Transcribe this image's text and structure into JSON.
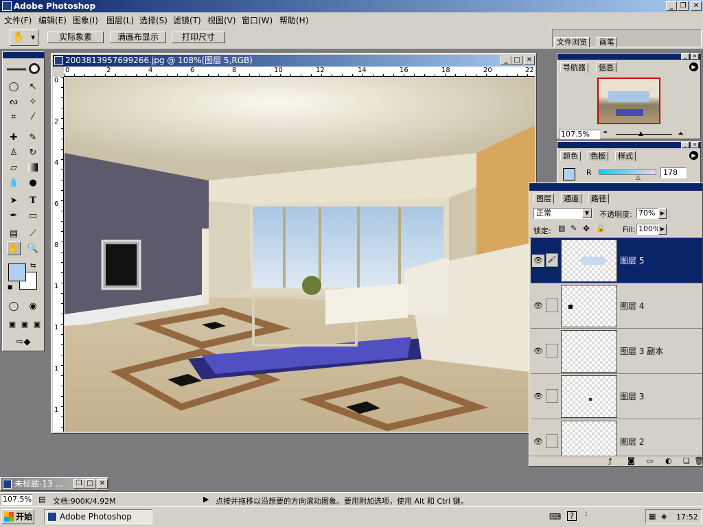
{
  "app": {
    "title": "Adobe Photoshop"
  },
  "menu": [
    "文件(F)",
    "编辑(E)",
    "图象(I)",
    "图层(L)",
    "选择(S)",
    "滤镜(T)",
    "视图(V)",
    "窗口(W)",
    "帮助(H)"
  ],
  "options": {
    "btn1": "实际象素",
    "btn2": "满画布显示",
    "btn3": "打印尺寸"
  },
  "palette_well": {
    "tab1": "文件浏览",
    "tab2": "画笔"
  },
  "document": {
    "title": "2003813957699266.jpg @ 108%(图层 5,RGB)",
    "ruler_h": [
      "0",
      "2",
      "4",
      "6",
      "8",
      "10",
      "12",
      "14",
      "16",
      "18",
      "20",
      "22"
    ],
    "ruler_v": [
      "0",
      "2",
      "4",
      "6",
      "8",
      "1",
      "1",
      "1",
      "1"
    ]
  },
  "navigator": {
    "tab1": "导航器",
    "tab2": "信息",
    "zoom": "107.5%"
  },
  "color": {
    "tab1": "颜色",
    "tab2": "色板",
    "tab3": "样式",
    "channel": "R",
    "value": "178",
    "fg": "#b0d0f0"
  },
  "layers": {
    "tab1": "图层",
    "tab2": "通道",
    "tab3": "路径",
    "blend": "正常",
    "opacity_label": "不透明度:",
    "opacity": "70%",
    "lock_label": "锁定:",
    "fill_label": "Fill:",
    "fill": "100%",
    "items": [
      {
        "name": "图层 5"
      },
      {
        "name": "图层 4"
      },
      {
        "name": "图层 3 副本"
      },
      {
        "name": "图层 3"
      },
      {
        "name": "图层 2"
      }
    ]
  },
  "minimized": {
    "title": "未标题-13 ..."
  },
  "status": {
    "zoom": "107.5%",
    "doc": "文档:900K/4.92M",
    "hint": "点按并拖移以沿想要的方向滚动图象。要用附加选项，使用 Alt 和 Ctrl 键。"
  },
  "taskbar": {
    "start": "开始",
    "task": "Adobe Photoshop",
    "time": "17:52"
  }
}
